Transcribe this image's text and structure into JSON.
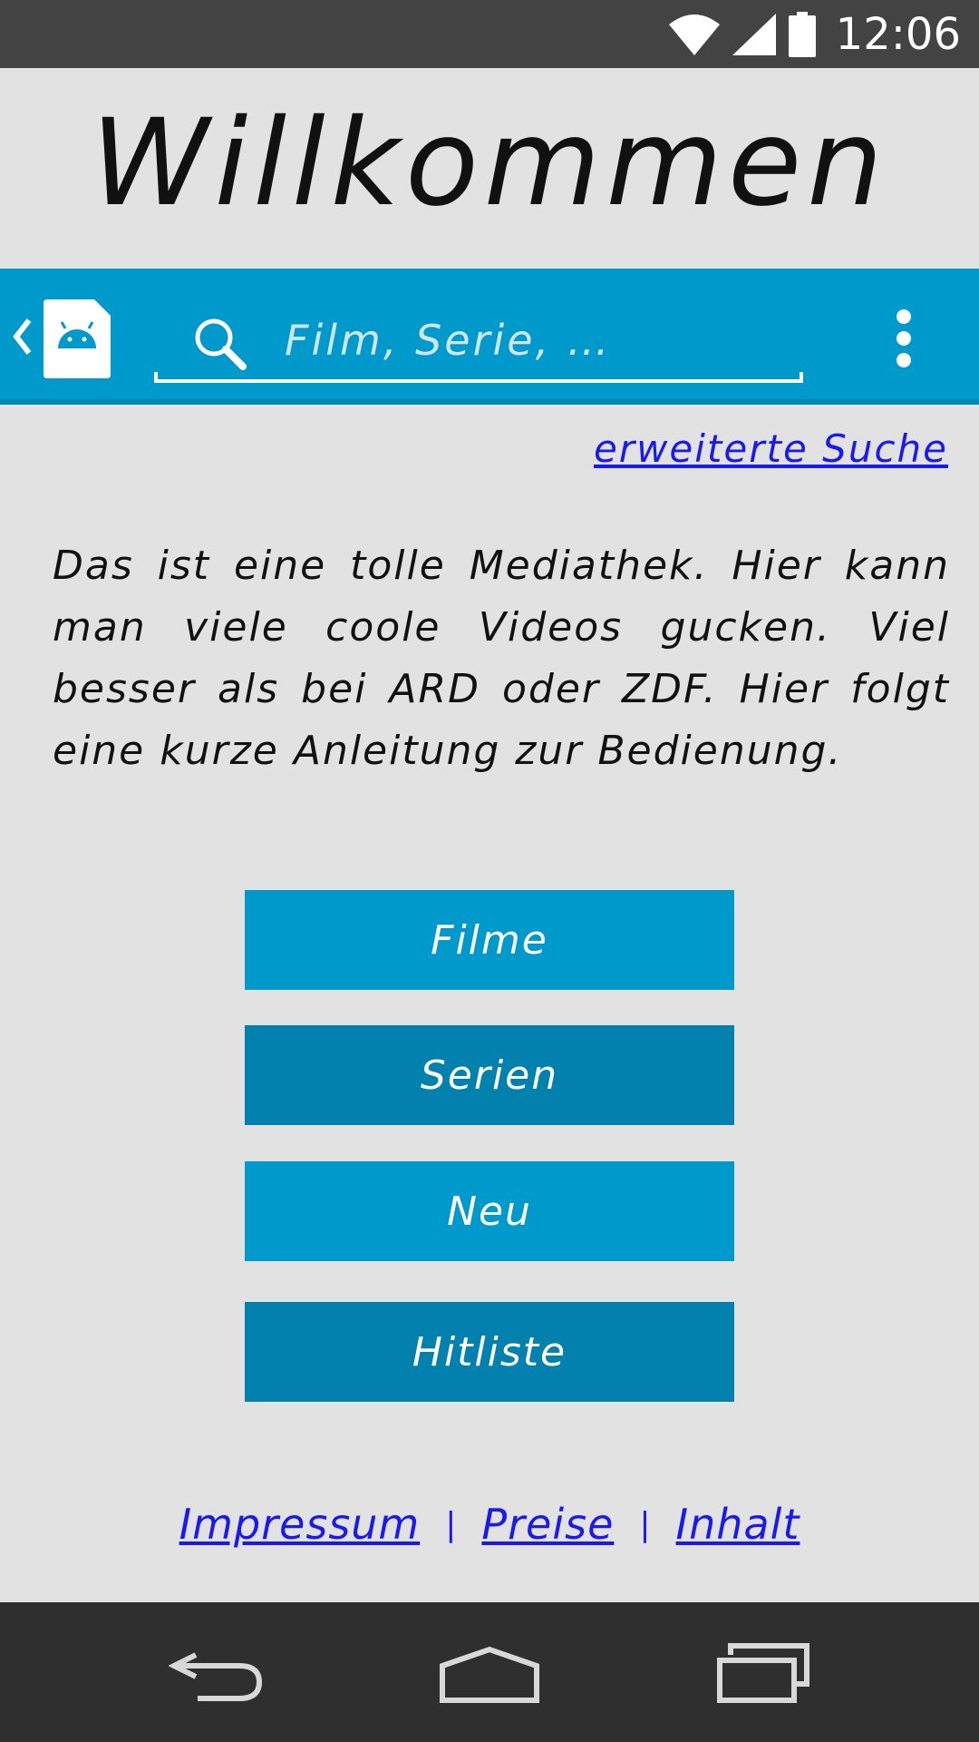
{
  "status_bar": {
    "time": "12:06",
    "icons": [
      "wifi-icon",
      "signal-icon",
      "battery-icon"
    ]
  },
  "title": "Willkommen",
  "action_bar": {
    "search_placeholder": "Film, Serie, …",
    "icons": [
      "back-caret-icon",
      "android-app-icon",
      "search-icon",
      "overflow-menu-icon"
    ],
    "color": "#0099cc"
  },
  "advanced_search_label": "erweiterte Suche",
  "intro_text": "Das ist eine tolle Mediathek. Hier kann man viele coole Videos gucken. Viel besser als bei ARD oder ZDF. Hier folgt eine kurze Anleitung zur Bedienung.",
  "buttons": {
    "filme": "Filme",
    "serien": "Serien",
    "neu": "Neu",
    "hitliste": "Hitliste"
  },
  "footer": {
    "impressum": "Impressum",
    "preise": "Preise",
    "inhalt": "Inhalt",
    "separator": "|"
  },
  "nav_bar": {
    "icons": [
      "back-icon",
      "home-icon",
      "recents-icon"
    ]
  },
  "colors": {
    "accent": "#0099cc",
    "accent_dark": "#0280ae",
    "link": "#1a1aee",
    "background": "#e2e2e2"
  }
}
